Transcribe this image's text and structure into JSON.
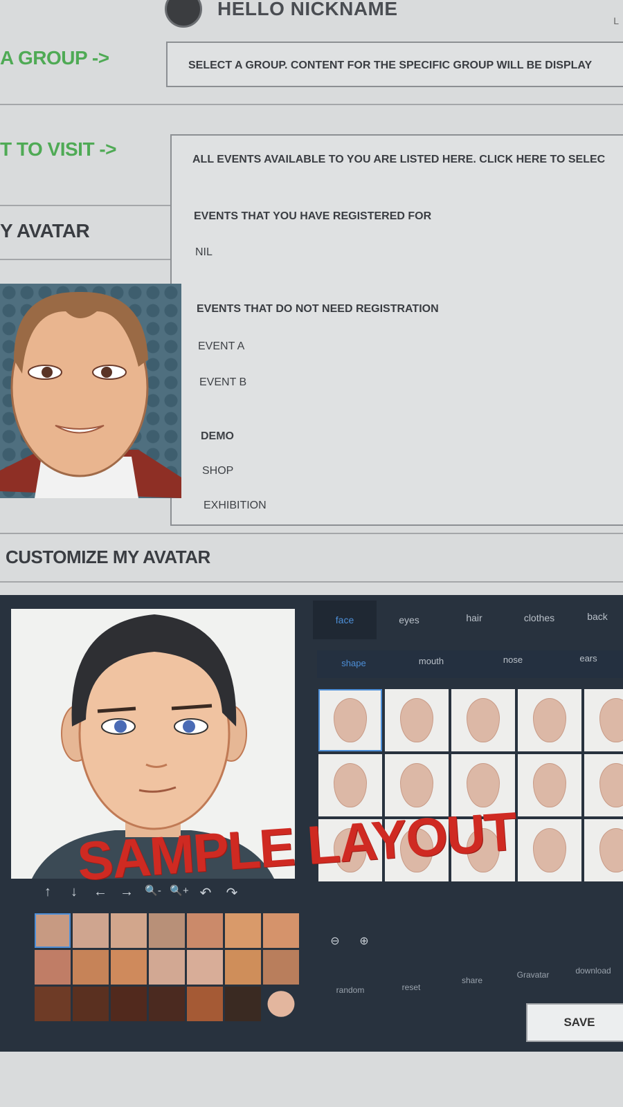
{
  "header": {
    "greeting": "HELLO NICKNAME",
    "corner": "L"
  },
  "group": {
    "label": "A GROUP ->",
    "prompt": "SELECT A GROUP. CONTENT FOR THE SPECIFIC GROUP WILL BE DISPLAY"
  },
  "events": {
    "label": "T TO VISIT ->",
    "intro": "ALL EVENTS AVAILABLE TO YOU ARE LISTED HERE. CLICK HERE TO SELEC",
    "registered_heading": "EVENTS THAT YOU HAVE REGISTERED FOR",
    "registered_value": "NIL",
    "no_registration_heading": "EVENTS THAT DO NOT NEED REGISTRATION",
    "items": [
      "EVENT A",
      "EVENT B"
    ],
    "demo_heading": "DEMO",
    "demo_items": [
      "SHOP",
      "EXHIBITION"
    ]
  },
  "avatar": {
    "heading": "Y AVATAR"
  },
  "customize": {
    "heading": "CUSTOMIZE MY AVATAR",
    "tabs": [
      "face",
      "eyes",
      "hair",
      "clothes",
      "back"
    ],
    "active_tab": "face",
    "subtabs": [
      "shape",
      "mouth",
      "nose",
      "ears"
    ],
    "active_subtab": "shape",
    "controls": [
      "↑",
      "↓",
      "←",
      "→",
      "🔍-",
      "🔍+",
      "↶",
      "↷"
    ],
    "zoom_controls": [
      "zoom-out",
      "zoom-in"
    ],
    "actions": [
      "random",
      "reset",
      "share",
      "Gravatar",
      "download"
    ],
    "save_label": "SAVE",
    "watermark": "SAMPLE LAYOUT",
    "swatch_colors": [
      "#c79a82",
      "#cfa58f",
      "#d2a68c",
      "#b89078",
      "#cb8a6a",
      "#d99a6a",
      "#d5936b",
      "#c07d66",
      "#c68358",
      "#cf8a5c",
      "#d2a893",
      "#d8ad98",
      "#cf8e5a",
      "#b97e5c",
      "#6e3b26",
      "#5a3020",
      "#51291d",
      "#4b2a20",
      "#a55a35",
      "#3a2a22",
      "#e3b69e"
    ]
  }
}
